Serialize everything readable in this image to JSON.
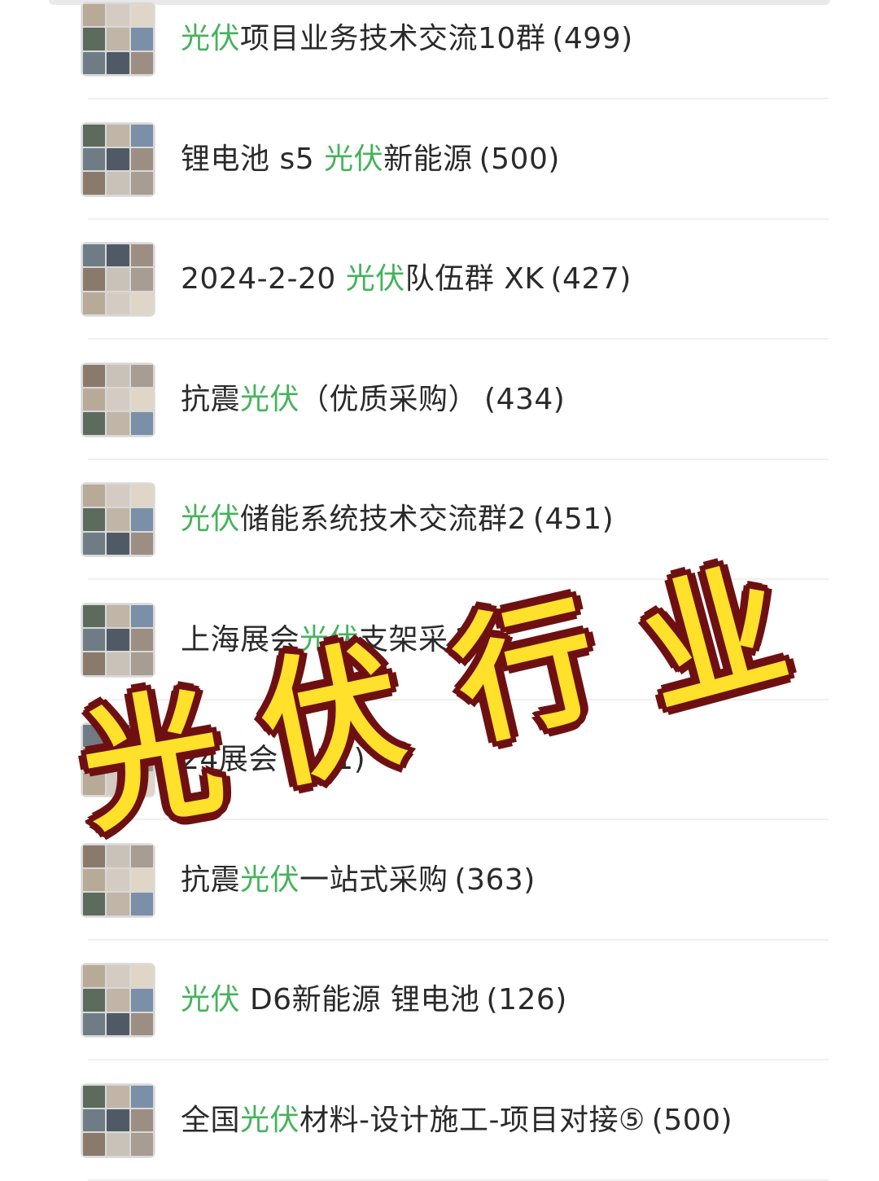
{
  "groups": [
    {
      "pre": "",
      "kw": "光伏",
      "post": "项目业务技术交流10群",
      "count": "(499)"
    },
    {
      "pre": "锂电池 s5 ",
      "kw": "光伏",
      "post": "新能源",
      "count": "(500)"
    },
    {
      "pre": "2024-2-20 ",
      "kw": "光伏",
      "post": "队伍群 XK",
      "count": "(427)"
    },
    {
      "pre": "抗震",
      "kw": "光伏",
      "post": "（优质采购）",
      "count": "(434)"
    },
    {
      "pre": "",
      "kw": "光伏",
      "post": "储能系统技术交流群2",
      "count": "(451)"
    },
    {
      "pre": "上海展会",
      "kw": "光伏",
      "post": "支架采",
      "count": "3)"
    },
    {
      "pre": "24",
      "kw": "",
      "post": "展会",
      "count": "(211)"
    },
    {
      "pre": "抗震",
      "kw": "光伏",
      "post": "一站式采购",
      "count": "(363)"
    },
    {
      "pre": "",
      "kw": "光伏",
      "post": " D6新能源 锂电池",
      "count": "(126)"
    },
    {
      "pre": "全国",
      "kw": "光伏",
      "post": "材料-设计施工-项目对接⑤",
      "count": "(500)"
    }
  ],
  "overlay": {
    "c1": "光",
    "c2": "伏",
    "c3": "行",
    "c4": "业"
  },
  "colors": {
    "keyword": "#44b35b",
    "sticker_fill": "#ffe02b",
    "sticker_outline": "#6e1012"
  }
}
